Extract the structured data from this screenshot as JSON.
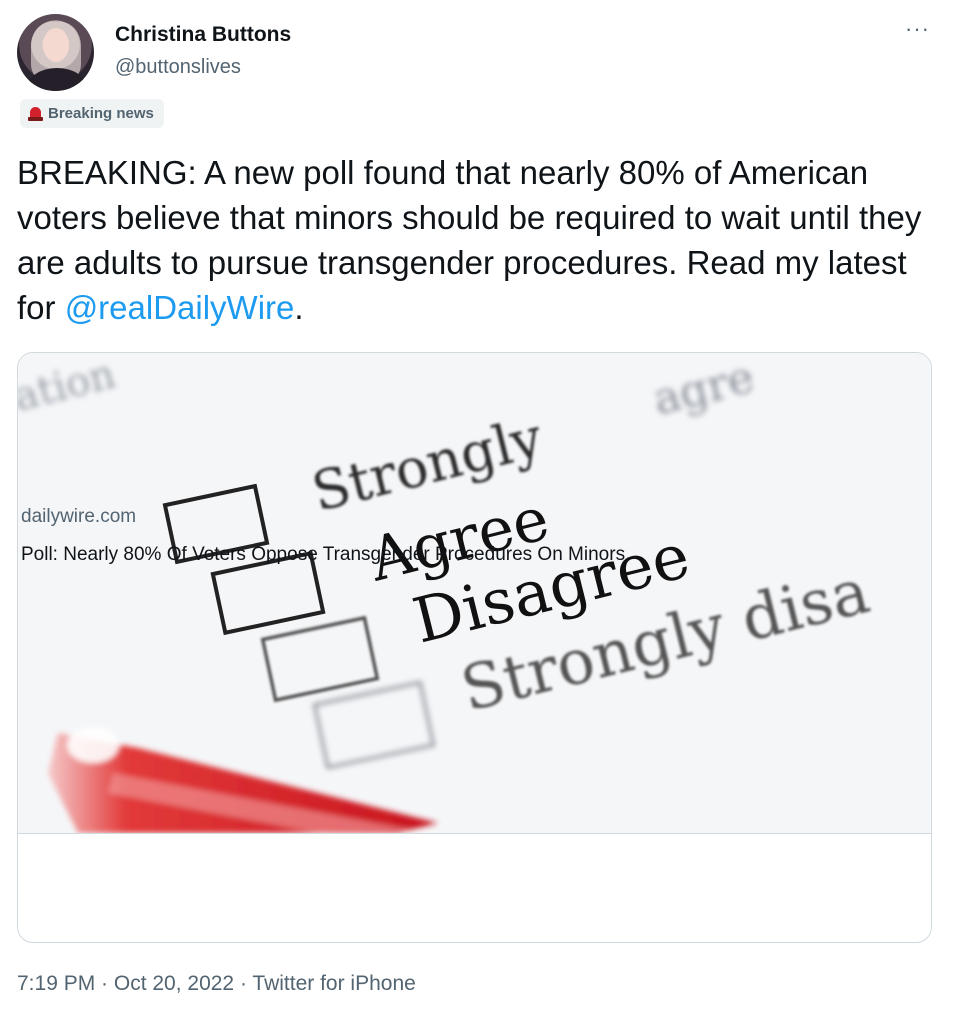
{
  "author": {
    "name": "Christina Buttons",
    "handle": "@buttonslives"
  },
  "badge": {
    "icon": "siren-icon",
    "label": "Breaking news"
  },
  "menu": {
    "more_label": "···"
  },
  "tweet": {
    "text_main": "BREAKING: A new poll found that nearly 80% of American voters believe that minors should be required to wait until they are adults to pursue transgender procedures. Read my latest for ",
    "mention": "@realDailyWire",
    "text_end": "."
  },
  "card": {
    "image_words": {
      "top_fragment": "ation",
      "top_right_fragment": "agre",
      "strongly_agree": "Strongly",
      "agree": "Agree",
      "disagree": "Disagree",
      "strongly_disagree": "Strongly disa"
    },
    "domain": "dailywire.com",
    "headline": "Poll: Nearly 80% Of Voters Oppose Transgender Procedures On Minors"
  },
  "footer": {
    "timestamp": "7:19 PM · Oct 20, 2022 · Twitter for iPhone"
  },
  "colors": {
    "link": "#1d9bf0",
    "secondary_text": "#536471",
    "pen_red": "#d0202a"
  }
}
